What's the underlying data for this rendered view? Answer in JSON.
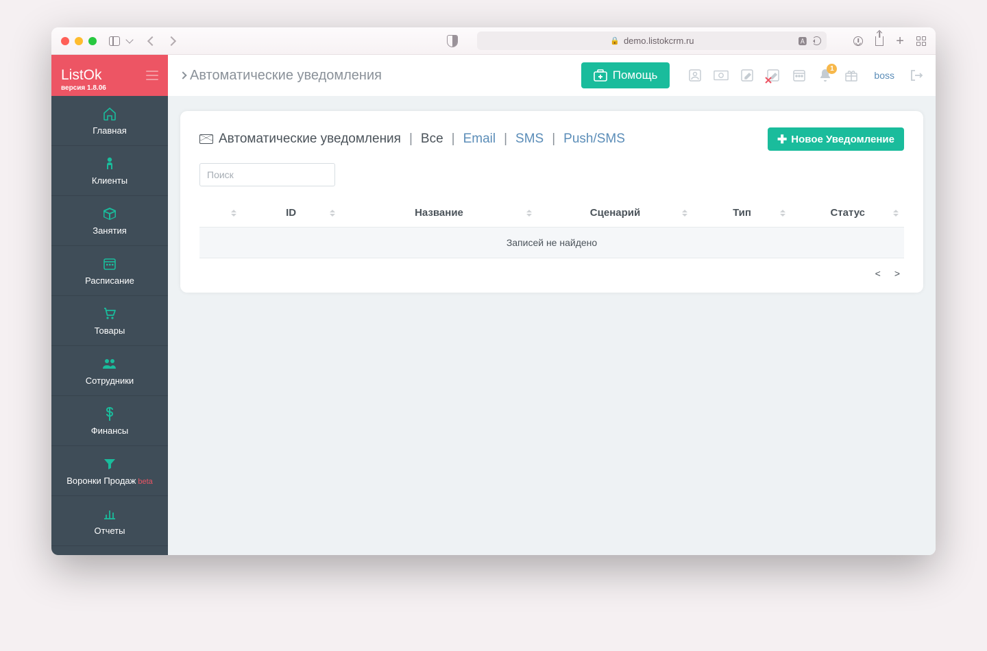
{
  "browser": {
    "url": "demo.listokcrm.ru"
  },
  "brand": {
    "name": "ListOk",
    "version": "версия 1.8.06"
  },
  "sidebar": {
    "items": [
      {
        "label": "Главная"
      },
      {
        "label": "Клиенты"
      },
      {
        "label": "Занятия"
      },
      {
        "label": "Расписание"
      },
      {
        "label": "Товары"
      },
      {
        "label": "Сотрудники"
      },
      {
        "label": "Финансы"
      },
      {
        "label": "Воронки Продаж",
        "suffix": "beta"
      },
      {
        "label": "Отчеты"
      }
    ]
  },
  "topbar": {
    "title": "Автоматические уведомления",
    "help": "Помощь",
    "user": "boss",
    "notif_count": "1"
  },
  "panel": {
    "heading": "Автоматические уведомления",
    "filters": {
      "all": "Все",
      "email": "Email",
      "sms": "SMS",
      "push": "Push/SMS"
    },
    "new_btn": "Новое Уведомление",
    "search_placeholder": "Поиск",
    "columns": {
      "id": "ID",
      "name": "Название",
      "scenario": "Сценарий",
      "type": "Тип",
      "status": "Статус"
    },
    "empty": "Записей не найдено",
    "pager": {
      "prev": "<",
      "next": ">"
    }
  }
}
